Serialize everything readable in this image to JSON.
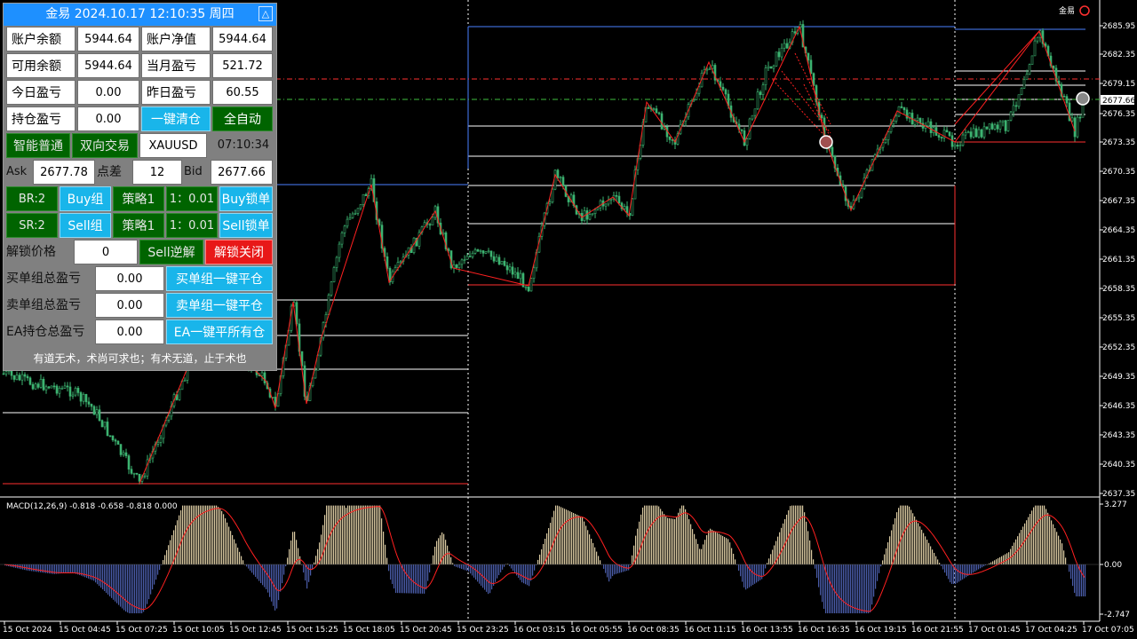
{
  "panel": {
    "title": "金易 2024.10.17 12:10:35 周四",
    "minimize_glyph": "△",
    "rows": {
      "balance_label": "账户余额",
      "balance_value": "5944.64",
      "equity_label": "账户净值",
      "equity_value": "5944.64",
      "free_label": "可用余额",
      "free_value": "5944.64",
      "month_pl_label": "当月盈亏",
      "month_pl_value": "521.72",
      "today_pl_label": "今日盈亏",
      "today_pl_value": "0.00",
      "yesterday_pl_label": "昨日盈亏",
      "yesterday_pl_value": "60.55",
      "position_pl_label": "持仓盈亏",
      "position_pl_value": "0.00",
      "close_all_button": "一键清仓",
      "auto_button": "全自动",
      "smart_mode_button": "智能普通",
      "two_way_button": "双向交易",
      "symbol": "XAUUSD",
      "clock": "07:10:34",
      "ask_label": "Ask",
      "ask_value": "2677.78",
      "spread_label": "点差",
      "spread_value": "12",
      "bid_label": "Bid",
      "bid_value": "2677.66",
      "br_label": "BR:2",
      "buy_group_button": "Buy组",
      "strategy_label_1": "策略1",
      "ratio_1": "1：0.01",
      "buy_lock_button": "Buy锁单",
      "sr_label": "SR:2",
      "sell_group_button": "Sell组",
      "strategy_label_2": "策略1",
      "ratio_2": "1：0.01",
      "sell_lock_button": "Sell锁单",
      "unlock_price_label": "解锁价格",
      "unlock_price_value": "0",
      "sell_reverse_button": "Sell逆解",
      "unlock_close_button": "解锁关闭",
      "buy_group_pl_label": "买单组总盈亏",
      "buy_group_pl_value": "0.00",
      "buy_group_close_button": "买单组一键平仓",
      "sell_group_pl_label": "卖单组总盈亏",
      "sell_group_pl_value": "0.00",
      "sell_group_close_button": "卖单组一键平仓",
      "ea_pl_label": "EA持仓总盈亏",
      "ea_pl_value": "0.00",
      "ea_close_button": "EA一键平所有仓"
    },
    "footer": "有道无术，术尚可求也；有术无道，止于术也"
  },
  "chart": {
    "corner_text": "金易",
    "price_ticks": [
      "2685.95",
      "2682.35",
      "2679.15",
      "2676.35",
      "2673.35",
      "2670.35",
      "2667.35",
      "2664.35",
      "2661.35",
      "2658.35",
      "2655.35",
      "2652.35",
      "2649.35",
      "2646.35",
      "2643.35",
      "2640.35",
      "2637.35"
    ],
    "current_price": "2677.66",
    "macd_label": "MACD(12,26,9) -0.818 -0.658 -0.818 0.000",
    "macd_ticks": [
      "3.277",
      "0.00",
      "-2.747"
    ],
    "time_ticks": [
      "15 Oct 2024",
      "15 Oct 04:45",
      "15 Oct 07:25",
      "15 Oct 10:05",
      "15 Oct 12:45",
      "15 Oct 15:25",
      "15 Oct 18:05",
      "15 Oct 20:45",
      "15 Oct 23:25",
      "16 Oct 03:15",
      "16 Oct 05:55",
      "16 Oct 08:35",
      "16 Oct 11:15",
      "16 Oct 13:55",
      "16 Oct 16:35",
      "16 Oct 19:15",
      "16 Oct 21:55",
      "17 Oct 01:45",
      "17 Oct 04:25",
      "17 Oct 07:05"
    ],
    "colors": {
      "candle": "#3cb371",
      "bear": "#1f5f1f",
      "zigzag": "#ff2020",
      "macd_pos": "#d8c8a0",
      "macd_neg": "#4a5ca8",
      "signal": "#ff2020",
      "grid": "#ffffff"
    }
  }
}
